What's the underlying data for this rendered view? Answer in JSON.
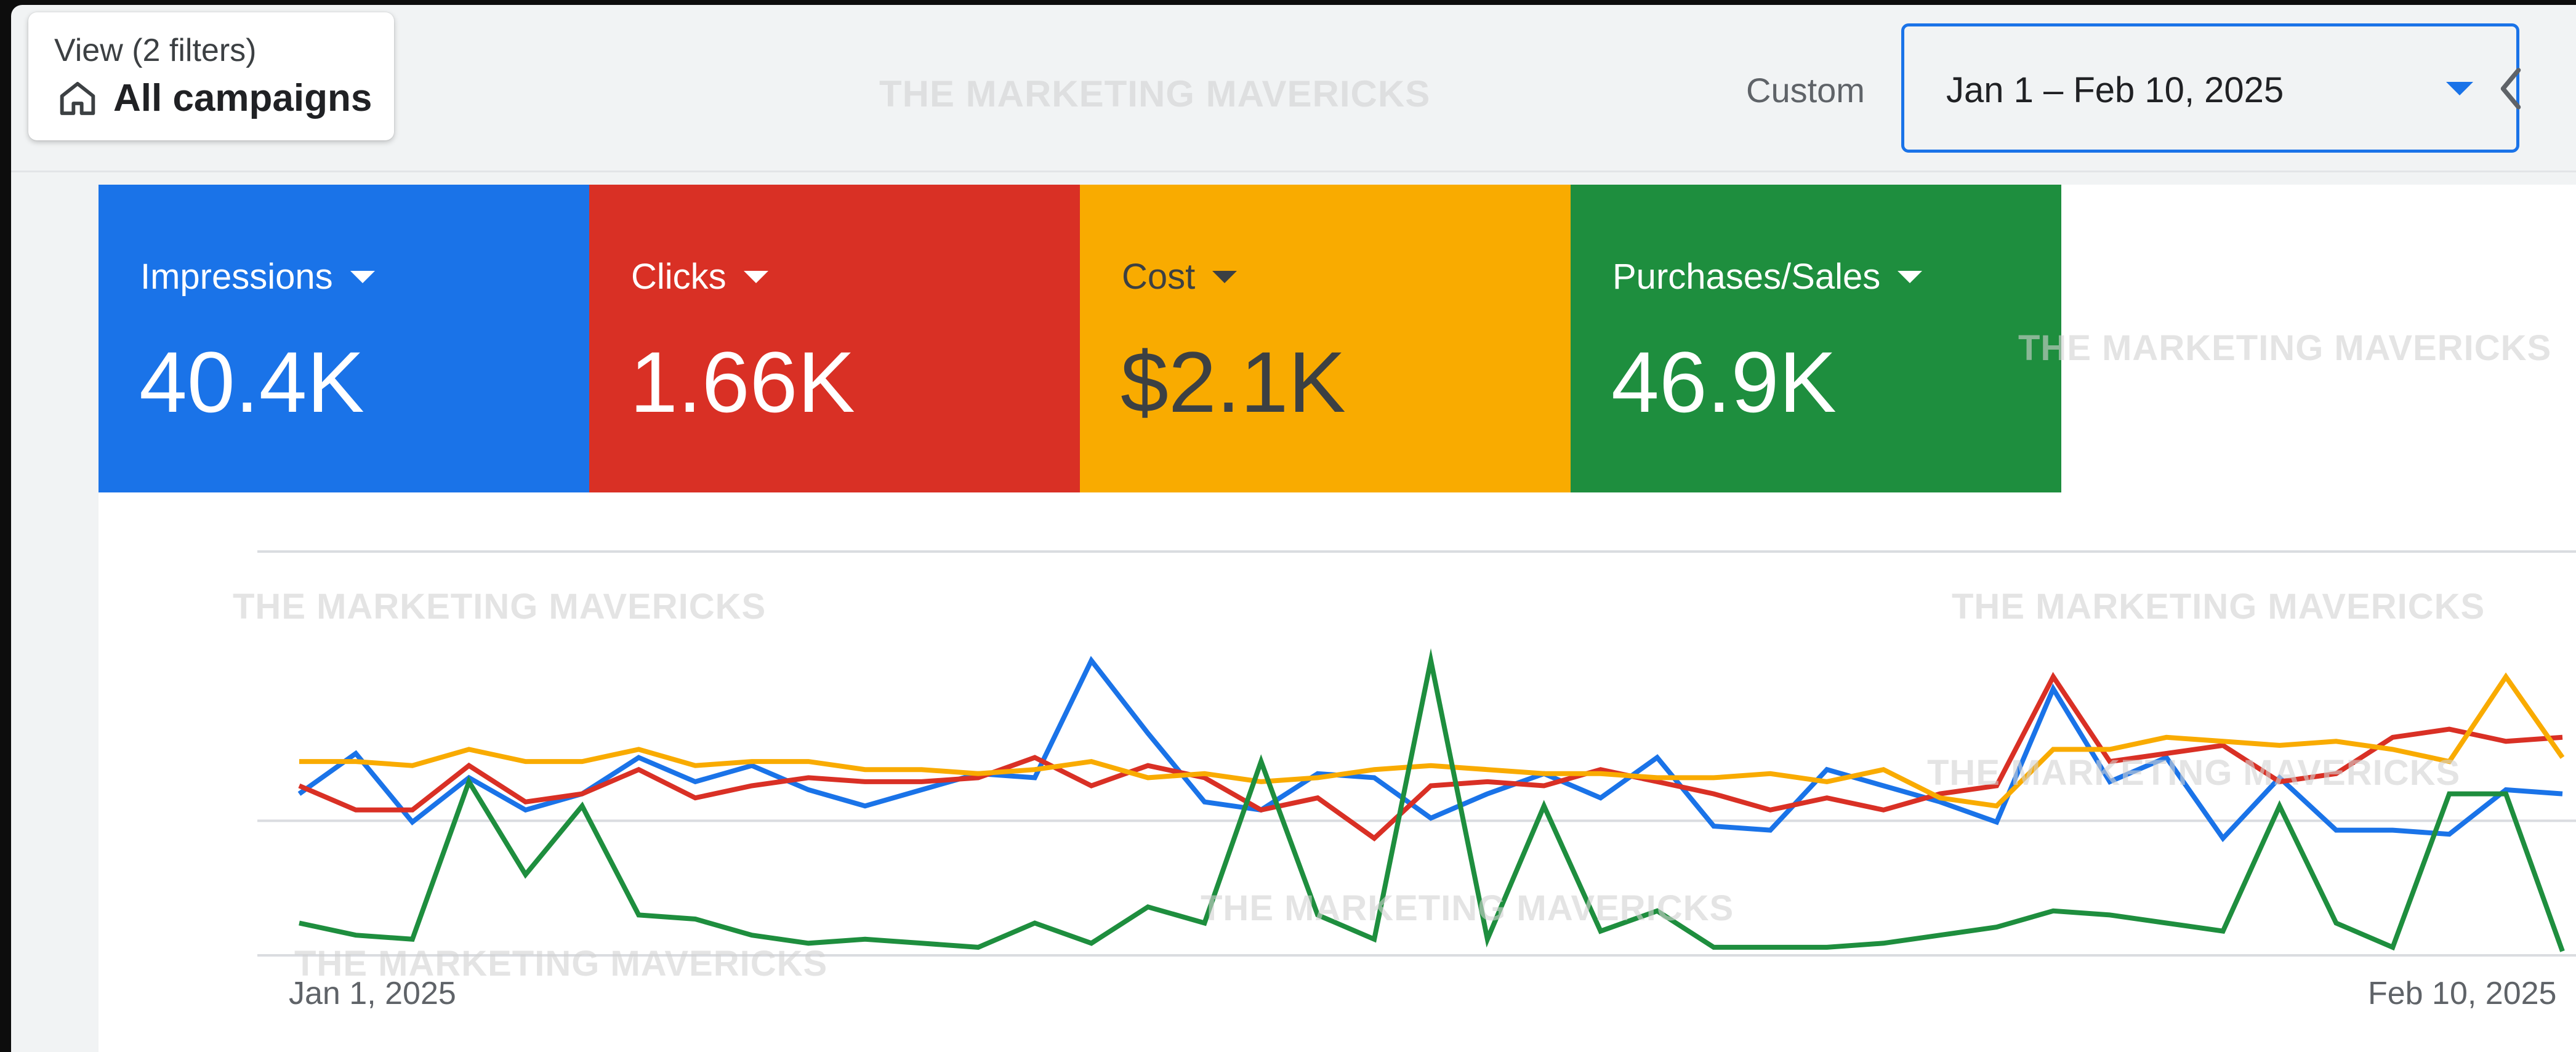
{
  "view": {
    "filters_label": "View (2 filters)",
    "title": "All campaigns"
  },
  "date_range": {
    "label": "Custom",
    "value": "Jan 1 – Feb 10, 2025"
  },
  "watermark": "THE MARKETING MAVERICKS",
  "metrics": [
    {
      "label": "Impressions",
      "value": "40.4K",
      "color": "#1a73e8"
    },
    {
      "label": "Clicks",
      "value": "1.66K",
      "color": "#d93025"
    },
    {
      "label": "Cost",
      "value": "$2.1K",
      "color": "#f9ab00"
    },
    {
      "label": "Purchases/Sales",
      "value": "46.9K",
      "color": "#1e8e3e"
    }
  ],
  "chart_data": {
    "type": "line",
    "x_start_label": "Jan 1, 2025",
    "x_end_label": "Feb 10, 2025",
    "grid": true,
    "series": [
      {
        "name": "Impressions",
        "color": "#1a73e8",
        "values": [
          0.4,
          0.5,
          0.33,
          0.44,
          0.36,
          0.4,
          0.49,
          0.43,
          0.47,
          0.41,
          0.37,
          0.41,
          0.45,
          0.44,
          0.73,
          0.55,
          0.38,
          0.36,
          0.45,
          0.44,
          0.34,
          0.4,
          0.45,
          0.39,
          0.49,
          0.32,
          0.31,
          0.46,
          0.42,
          0.38,
          0.33,
          0.66,
          0.43,
          0.49,
          0.29,
          0.44,
          0.31,
          0.31,
          0.3,
          0.41,
          0.4
        ]
      },
      {
        "name": "Clicks",
        "color": "#d93025",
        "values": [
          0.42,
          0.36,
          0.36,
          0.47,
          0.38,
          0.4,
          0.46,
          0.39,
          0.42,
          0.44,
          0.43,
          0.43,
          0.44,
          0.49,
          0.42,
          0.47,
          0.44,
          0.36,
          0.39,
          0.29,
          0.42,
          0.43,
          0.42,
          0.46,
          0.43,
          0.4,
          0.36,
          0.39,
          0.36,
          0.4,
          0.42,
          0.69,
          0.48,
          0.5,
          0.52,
          0.43,
          0.45,
          0.54,
          0.56,
          0.53,
          0.54
        ]
      },
      {
        "name": "Cost",
        "color": "#f9ab00",
        "values": [
          0.48,
          0.48,
          0.47,
          0.51,
          0.48,
          0.48,
          0.51,
          0.47,
          0.48,
          0.48,
          0.46,
          0.46,
          0.45,
          0.46,
          0.48,
          0.44,
          0.45,
          0.43,
          0.44,
          0.46,
          0.47,
          0.46,
          0.45,
          0.45,
          0.44,
          0.44,
          0.45,
          0.43,
          0.46,
          0.39,
          0.37,
          0.51,
          0.51,
          0.54,
          0.53,
          0.52,
          0.53,
          0.51,
          0.48,
          0.69,
          0.49
        ]
      },
      {
        "name": "Purchases/Sales",
        "color": "#1e8e3e",
        "values": [
          0.08,
          0.05,
          0.04,
          0.43,
          0.2,
          0.37,
          0.1,
          0.09,
          0.05,
          0.03,
          0.04,
          0.03,
          0.02,
          0.08,
          0.03,
          0.12,
          0.08,
          0.48,
          0.1,
          0.04,
          0.73,
          0.04,
          0.37,
          0.06,
          0.11,
          0.02,
          0.02,
          0.02,
          0.03,
          0.05,
          0.07,
          0.11,
          0.1,
          0.08,
          0.06,
          0.37,
          0.08,
          0.02,
          0.4,
          0.4,
          0.01
        ]
      }
    ]
  }
}
